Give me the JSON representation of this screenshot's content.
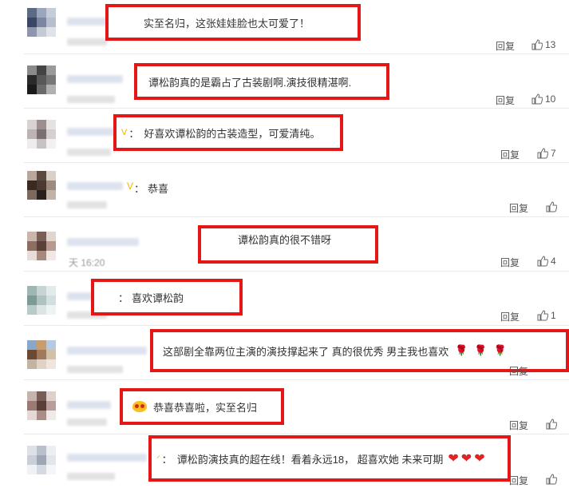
{
  "reply_label": "回复",
  "accent_color": "#e51616",
  "comments": [
    {
      "text": "实至名归，这张娃娃脸也太可爱了！",
      "likes": "13",
      "has_colon": true
    },
    {
      "text": "谭松韵真的是霸占了古装剧啊.演技很精湛啊.",
      "likes": "10",
      "has_colon": false
    },
    {
      "text": "好喜欢谭松韵的古装造型，可爱清纯。",
      "likes": "7",
      "has_colon": true,
      "badge": "V"
    },
    {
      "text": "恭喜",
      "likes": "",
      "has_colon": true,
      "badge": "V"
    },
    {
      "text": "谭松韵真的很不错呀",
      "likes": "4",
      "has_colon": false,
      "time_fragment": "天 16:20"
    },
    {
      "text": "喜欢谭松韵",
      "likes": "1",
      "has_colon": true
    },
    {
      "text": "这部剧全靠两位主演的演技撑起来了 真的很优秀 男主我也喜欢",
      "likes": "",
      "has_colon": false,
      "trailing_icons": [
        "rose-icon",
        "rose-icon",
        "rose-icon"
      ]
    },
    {
      "text": "恭喜恭喜啦，实至名归",
      "likes": "",
      "has_colon": false,
      "lead_icon": "blush-emoji-icon"
    },
    {
      "text": "谭松韵演技真的超在线！看着永远18， 超喜欢她 未来可期",
      "likes": "",
      "has_colon": true,
      "trailing_icons": [
        "heart-icon",
        "heart-icon",
        "heart-icon"
      ]
    }
  ]
}
